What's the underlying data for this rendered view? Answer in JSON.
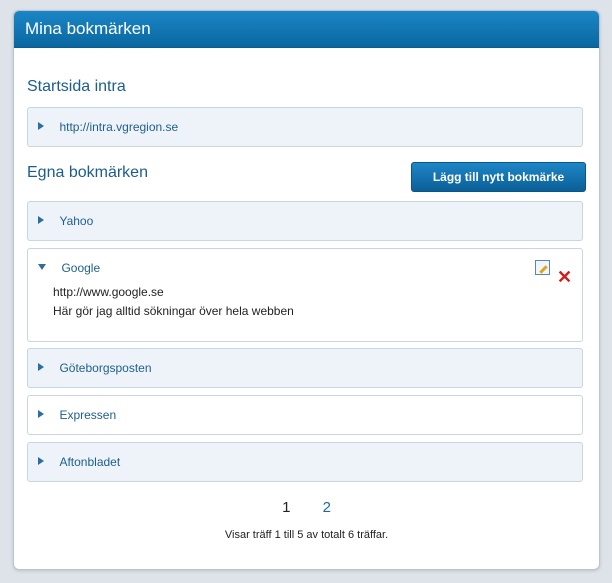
{
  "header": {
    "title": "Mina bokmärken"
  },
  "startpage": {
    "title": "Startsida intra",
    "item": {
      "label": "http://intra.vgregion.se"
    }
  },
  "own": {
    "title": "Egna bokmärken",
    "add_button": "Lägg till nytt bokmärke",
    "items": [
      {
        "label": "Yahoo"
      },
      {
        "label": "Google",
        "url": "http://www.google.se",
        "description": "Här gör jag alltid sökningar över hela webben"
      },
      {
        "label": "Göteborgsposten"
      },
      {
        "label": "Expressen"
      },
      {
        "label": "Aftonbladet"
      }
    ]
  },
  "pagination": {
    "pages": [
      "1",
      "2"
    ],
    "current": "1",
    "summary": "Visar träff 1 till 5 av totalt 6 träffar."
  },
  "icons": {
    "expand": "triangle-right-icon",
    "collapse": "triangle-down-icon",
    "edit": "edit-icon",
    "delete": "delete-icon"
  },
  "colors": {
    "header_bg": "#0a679f",
    "accent": "#1f5f8f",
    "delete": "#d31b1b"
  }
}
